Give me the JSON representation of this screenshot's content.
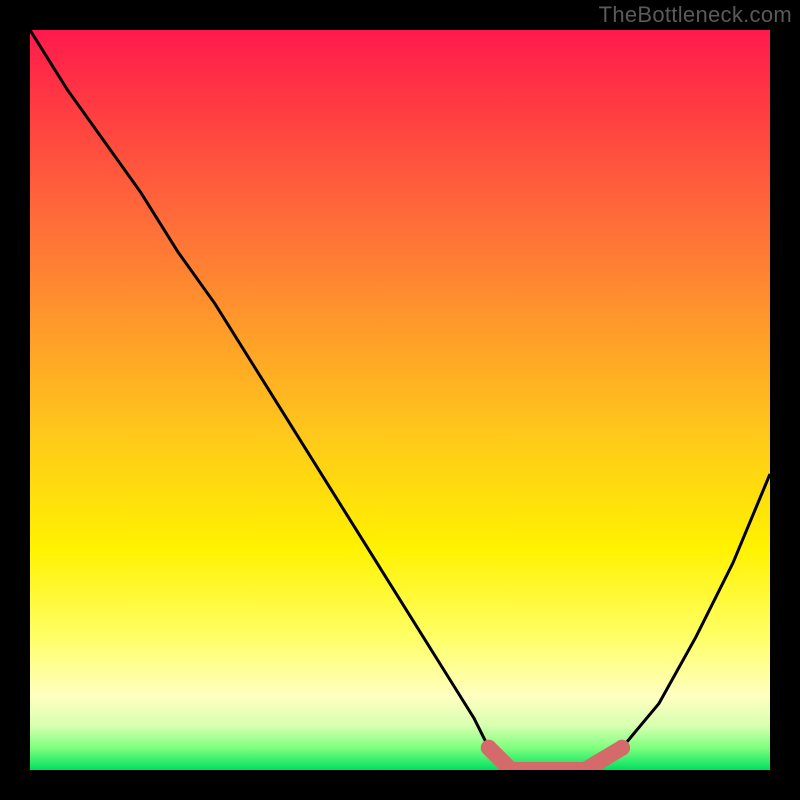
{
  "watermark": {
    "text": "TheBottleneck.com"
  },
  "colors": {
    "curve_stroke": "#000000",
    "optimal_stroke": "#d46a6a",
    "background_black": "#000000"
  },
  "chart_data": {
    "type": "line",
    "title": "",
    "xlabel": "",
    "ylabel": "",
    "xlim": [
      0,
      100
    ],
    "ylim": [
      0,
      100
    ],
    "grid": false,
    "series": [
      {
        "name": "bottleneck-curve",
        "x": [
          0,
          5,
          10,
          15,
          20,
          25,
          30,
          35,
          40,
          45,
          50,
          55,
          60,
          62,
          65,
          70,
          75,
          80,
          85,
          90,
          95,
          100
        ],
        "values": [
          100,
          92,
          85,
          78,
          70,
          63,
          55,
          47,
          39,
          31,
          23,
          15,
          7,
          3,
          0,
          0,
          0,
          3,
          9,
          18,
          28,
          40
        ]
      }
    ],
    "optimal_range": {
      "x_start": 62,
      "x_end": 80,
      "y": 0
    }
  }
}
